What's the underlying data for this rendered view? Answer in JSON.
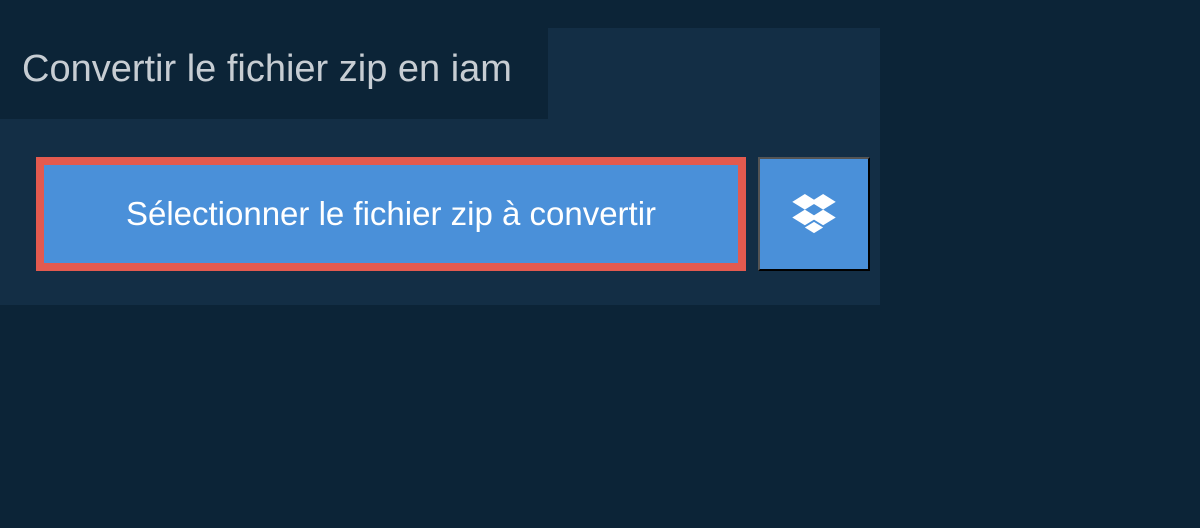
{
  "header": {
    "title": "Convertir le fichier zip en iam"
  },
  "buttons": {
    "select_label": "Sélectionner le fichier zip à convertir"
  },
  "colors": {
    "background_outer": "#0c2437",
    "background_inner": "#132e45",
    "button_bg": "#4a90d9",
    "button_border_highlight": "#e35a4f",
    "text_light": "#c7cdd3"
  }
}
